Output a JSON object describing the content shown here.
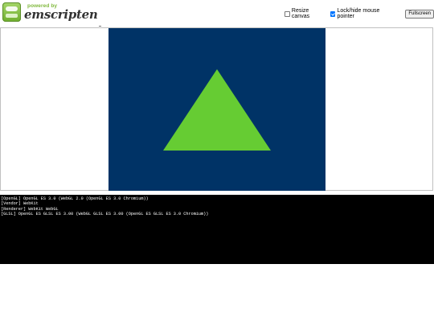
{
  "header": {
    "logo": {
      "powered_by": "powered by",
      "name": "emscripten"
    },
    "controls": {
      "resize_canvas": {
        "label": "Resize canvas",
        "checked": false
      },
      "lock_mouse": {
        "label": "Lock/hide mouse pointer",
        "checked": true
      },
      "fullscreen_label": "Fullscreen"
    }
  },
  "canvas": {
    "background": "#003366",
    "triangle_color": "#66cc33"
  },
  "console": {
    "lines": [
      "[OpenGL] OpenGL ES 3.0 (WebGL 2.0 (OpenGL ES 3.0 Chromium))",
      "[Vendor] WebKit",
      "[Renderer] WebKit WebGL",
      "[GLSL] OpenGL ES GLSL ES 3.00 (WebGL GLSL ES 3.00 (OpenGL ES GLSL ES 3.0 Chromium))"
    ]
  }
}
